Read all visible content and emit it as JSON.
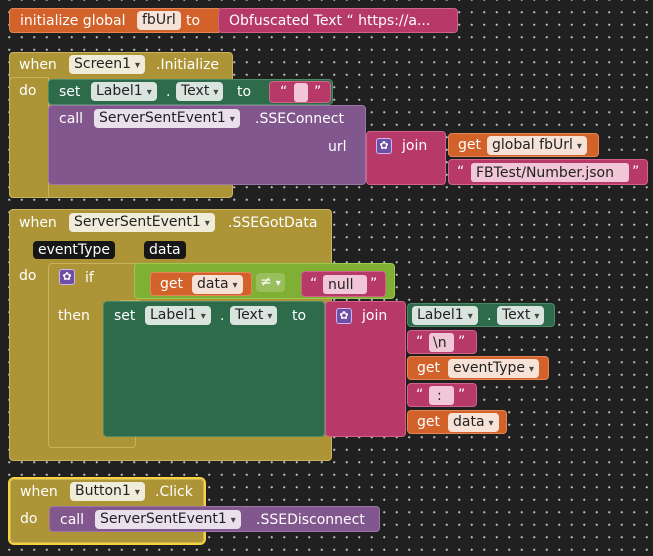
{
  "global_block": {
    "keyword": "initialize global",
    "var_name": "fbUrl",
    "to": "to",
    "value": "Obfuscated Text “ https://a..."
  },
  "screen_init": {
    "when": "when",
    "component": "Screen1",
    "event": ".Initialize",
    "do": "do",
    "set": "set",
    "label_comp": "Label1",
    "dot": ".",
    "prop": "Text",
    "to": "to",
    "str_open": "“",
    "str_close": "”",
    "call": "call",
    "call_comp": "ServerSentEvent1",
    "method": ".SSEConnect",
    "url_label": "url",
    "join": "join",
    "get": "get",
    "get_var": "global fbUrl",
    "path_text": "FBTest/Number.json"
  },
  "got_data": {
    "when": "when",
    "component": "ServerSentEvent1",
    "event": ".SSEGotData",
    "param1": "eventType",
    "param2": "data",
    "do": "do",
    "if": "if",
    "then": "then",
    "get": "get",
    "get_var": "data",
    "neq": "≠",
    "null_text": "null",
    "set": "set",
    "label_comp": "Label1",
    "dot": ".",
    "prop": "Text",
    "to": "to",
    "join": "join",
    "j_comp": "Label1",
    "j_prop": "Text",
    "newline": "\\n",
    "get_event": "eventType",
    "colon": ":",
    "get_data": "data",
    "str_open": "“",
    "str_close": "”"
  },
  "button_click": {
    "when": "when",
    "component": "Button1",
    "event": ".Click",
    "do": "do",
    "call": "call",
    "call_comp": "ServerSentEvent1",
    "method": ".SSEDisconnect"
  },
  "colors": {
    "event": "#ad9436",
    "set": "#2e6b4b",
    "call": "#82578e",
    "text": "#b63968",
    "variable": "#d2622a",
    "logic": "#7fb033",
    "selected": "#f6d33c"
  }
}
